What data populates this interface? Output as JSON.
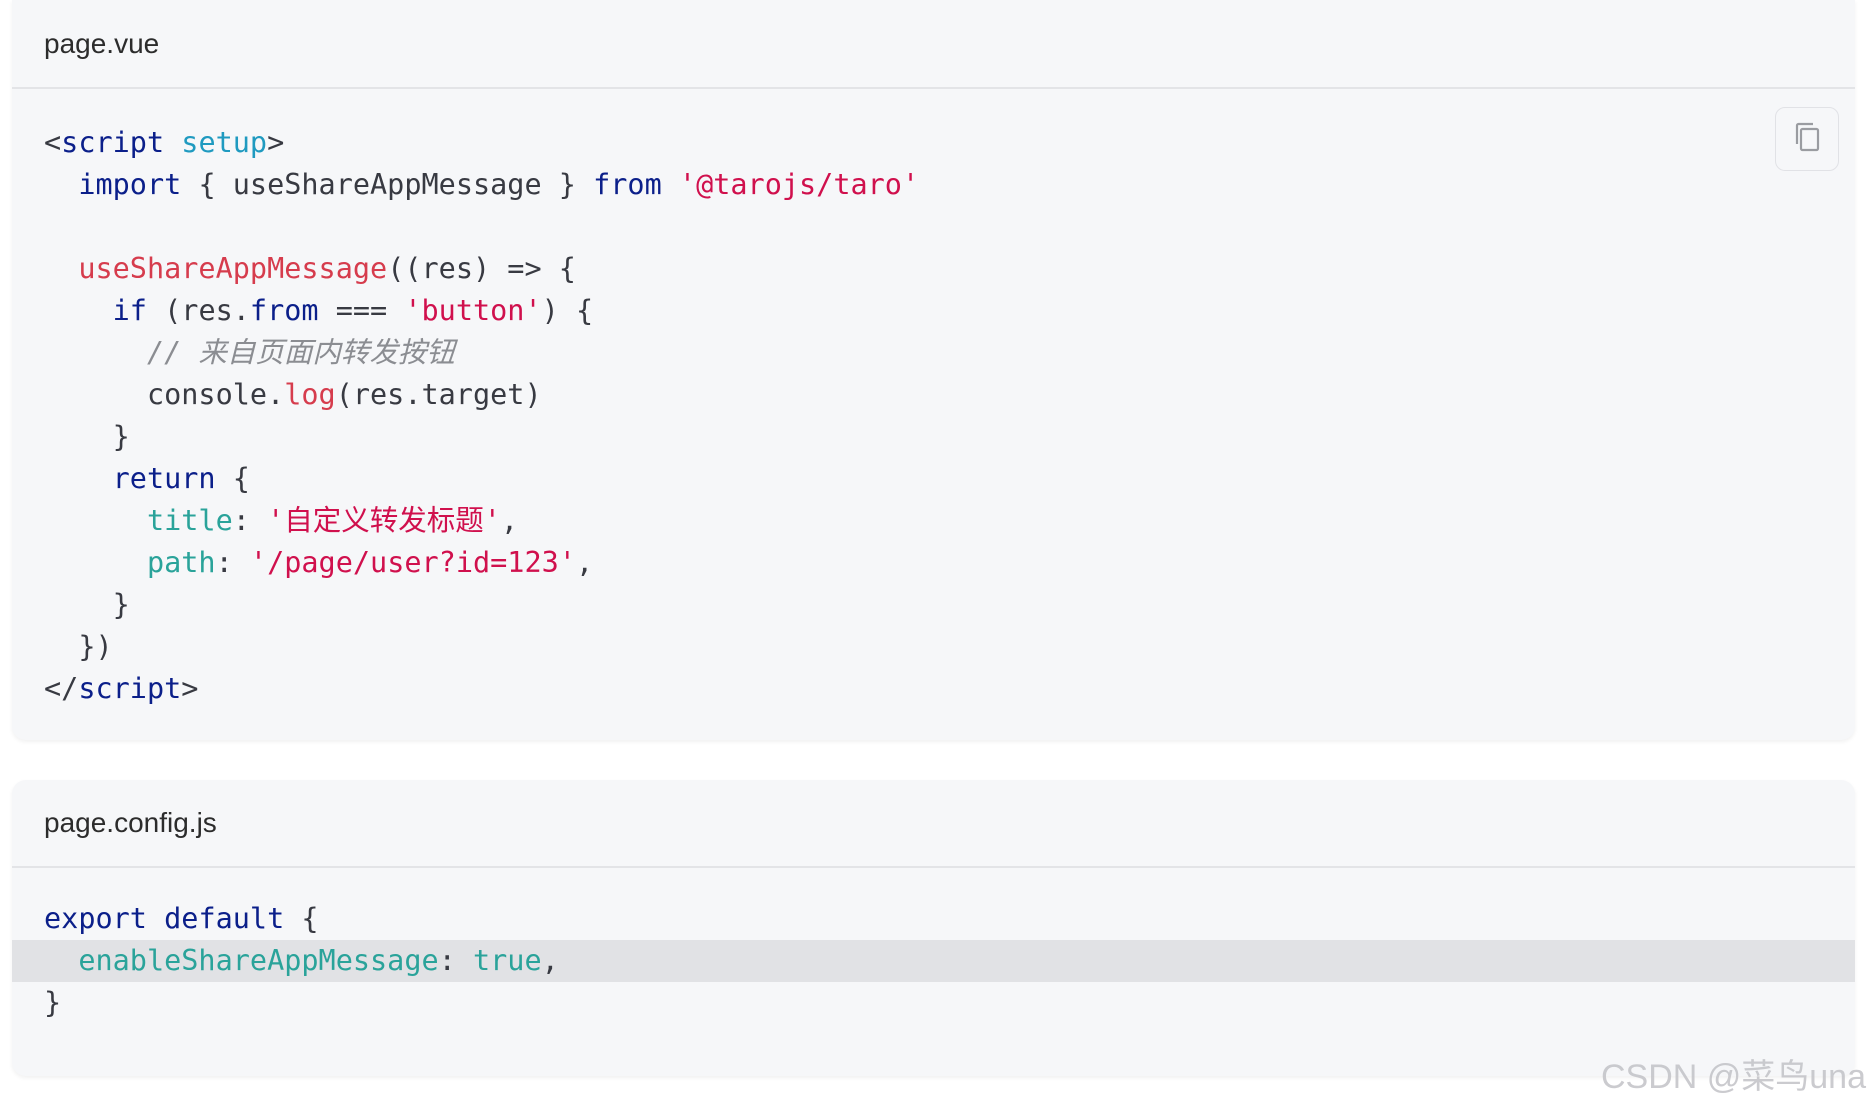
{
  "blocks": [
    {
      "filename": "page.vue",
      "copy_icon": "copy-icon",
      "lines": [
        [
          {
            "t": "<",
            "c": "punc"
          },
          {
            "t": "script",
            "c": "kw"
          },
          {
            "t": " ",
            "c": "punc"
          },
          {
            "t": "setup",
            "c": "attr"
          },
          {
            "t": ">",
            "c": "punc"
          }
        ],
        [
          {
            "t": "  ",
            "c": "punc"
          },
          {
            "t": "import",
            "c": "kw"
          },
          {
            "t": " { useShareAppMessage } ",
            "c": "punc"
          },
          {
            "t": "from",
            "c": "kw"
          },
          {
            "t": " ",
            "c": "punc"
          },
          {
            "t": "'@tarojs/taro'",
            "c": "str"
          }
        ],
        [],
        [
          {
            "t": "  ",
            "c": "punc"
          },
          {
            "t": "useShareAppMessage",
            "c": "fn"
          },
          {
            "t": "((res) => {",
            "c": "punc"
          }
        ],
        [
          {
            "t": "    ",
            "c": "punc"
          },
          {
            "t": "if",
            "c": "kw"
          },
          {
            "t": " (res.",
            "c": "punc"
          },
          {
            "t": "from",
            "c": "kw"
          },
          {
            "t": " === ",
            "c": "punc"
          },
          {
            "t": "'button'",
            "c": "str"
          },
          {
            "t": ") {",
            "c": "punc"
          }
        ],
        [
          {
            "t": "      ",
            "c": "punc"
          },
          {
            "t": "// 来自页面内转发按钮",
            "c": "cmt"
          }
        ],
        [
          {
            "t": "      console.",
            "c": "punc"
          },
          {
            "t": "log",
            "c": "fn"
          },
          {
            "t": "(res.target)",
            "c": "punc"
          }
        ],
        [
          {
            "t": "    }",
            "c": "punc"
          }
        ],
        [
          {
            "t": "    ",
            "c": "punc"
          },
          {
            "t": "return",
            "c": "kw"
          },
          {
            "t": " {",
            "c": "punc"
          }
        ],
        [
          {
            "t": "      ",
            "c": "punc"
          },
          {
            "t": "title",
            "c": "prop"
          },
          {
            "t": ": ",
            "c": "punc"
          },
          {
            "t": "'自定义转发标题'",
            "c": "str"
          },
          {
            "t": ",",
            "c": "punc"
          }
        ],
        [
          {
            "t": "      ",
            "c": "punc"
          },
          {
            "t": "path",
            "c": "prop"
          },
          {
            "t": ": ",
            "c": "punc"
          },
          {
            "t": "'/page/user?id=123'",
            "c": "str"
          },
          {
            "t": ",",
            "c": "punc"
          }
        ],
        [
          {
            "t": "    }",
            "c": "punc"
          }
        ],
        [
          {
            "t": "  })",
            "c": "punc"
          }
        ],
        [
          {
            "t": "</",
            "c": "punc"
          },
          {
            "t": "script",
            "c": "kw"
          },
          {
            "t": ">",
            "c": "punc"
          }
        ]
      ],
      "highlighted": []
    },
    {
      "filename": "page.config.js",
      "lines": [
        [
          {
            "t": "export",
            "c": "kw"
          },
          {
            "t": " ",
            "c": "punc"
          },
          {
            "t": "default",
            "c": "kw"
          },
          {
            "t": " {",
            "c": "punc"
          }
        ],
        [
          {
            "t": "  ",
            "c": "punc"
          },
          {
            "t": "enableShareAppMessage",
            "c": "prop"
          },
          {
            "t": ": ",
            "c": "punc"
          },
          {
            "t": "true",
            "c": "bool"
          },
          {
            "t": ",",
            "c": "punc"
          }
        ],
        [
          {
            "t": "}",
            "c": "punc"
          }
        ]
      ],
      "highlighted": [
        1
      ]
    }
  ],
  "watermark": "CSDN @菜鸟una"
}
